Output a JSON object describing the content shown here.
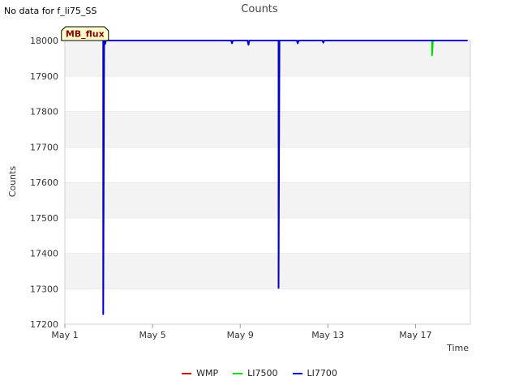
{
  "note": "No data for f_li75_SS",
  "chart_data": {
    "type": "line",
    "title": "Counts",
    "xlabel": "Time",
    "ylabel": "Counts",
    "xlim": [
      "2024-05-01",
      "2024-05-19T12:00"
    ],
    "ylim": [
      17200,
      18000
    ],
    "x_ticks": [
      "May 1",
      "May 5",
      "May 9",
      "May 13",
      "May 17"
    ],
    "y_ticks": [
      17200,
      17300,
      17400,
      17500,
      17600,
      17700,
      17800,
      17900,
      18000
    ],
    "grid": "horizontal bands",
    "legend_position": "bottom",
    "annotation": {
      "label": "MB_flux",
      "x": "2024-05-01T22:00",
      "y": 18000
    },
    "series": [
      {
        "name": "WMP",
        "color": "#cc0000",
        "points": []
      },
      {
        "name": "LI7500",
        "color": "#00dd00",
        "points": [
          [
            "2024-05-17T18:00",
            18000
          ],
          [
            "2024-05-17T18:00",
            17958
          ],
          [
            "2024-05-17T19:00",
            17998
          ]
        ]
      },
      {
        "name": "LI7700",
        "color": "#0000cc",
        "points": [
          [
            "2024-05-02T18:00",
            18000
          ],
          [
            "2024-05-02T18:00",
            17228
          ],
          [
            "2024-05-02T19:00",
            18000
          ],
          [
            "2024-05-02T20:00",
            17990
          ],
          [
            "2024-05-02T21:00",
            18000
          ],
          [
            "2024-05-08T14:00",
            18000
          ],
          [
            "2024-05-08T15:00",
            17992
          ],
          [
            "2024-05-08T16:00",
            18000
          ],
          [
            "2024-05-09T08:00",
            18000
          ],
          [
            "2024-05-09T09:00",
            17988
          ],
          [
            "2024-05-09T10:00",
            18000
          ],
          [
            "2024-05-10T18:00",
            18000
          ],
          [
            "2024-05-10T18:00",
            17302
          ],
          [
            "2024-05-10T19:00",
            18000
          ],
          [
            "2024-05-11T14:00",
            18000
          ],
          [
            "2024-05-11T15:00",
            17992
          ],
          [
            "2024-05-11T16:00",
            18000
          ],
          [
            "2024-05-12T18:00",
            18000
          ],
          [
            "2024-05-12T19:00",
            17994
          ],
          [
            "2024-05-12T20:00",
            18000
          ],
          [
            "2024-05-19T09:00",
            18000
          ]
        ]
      }
    ]
  }
}
